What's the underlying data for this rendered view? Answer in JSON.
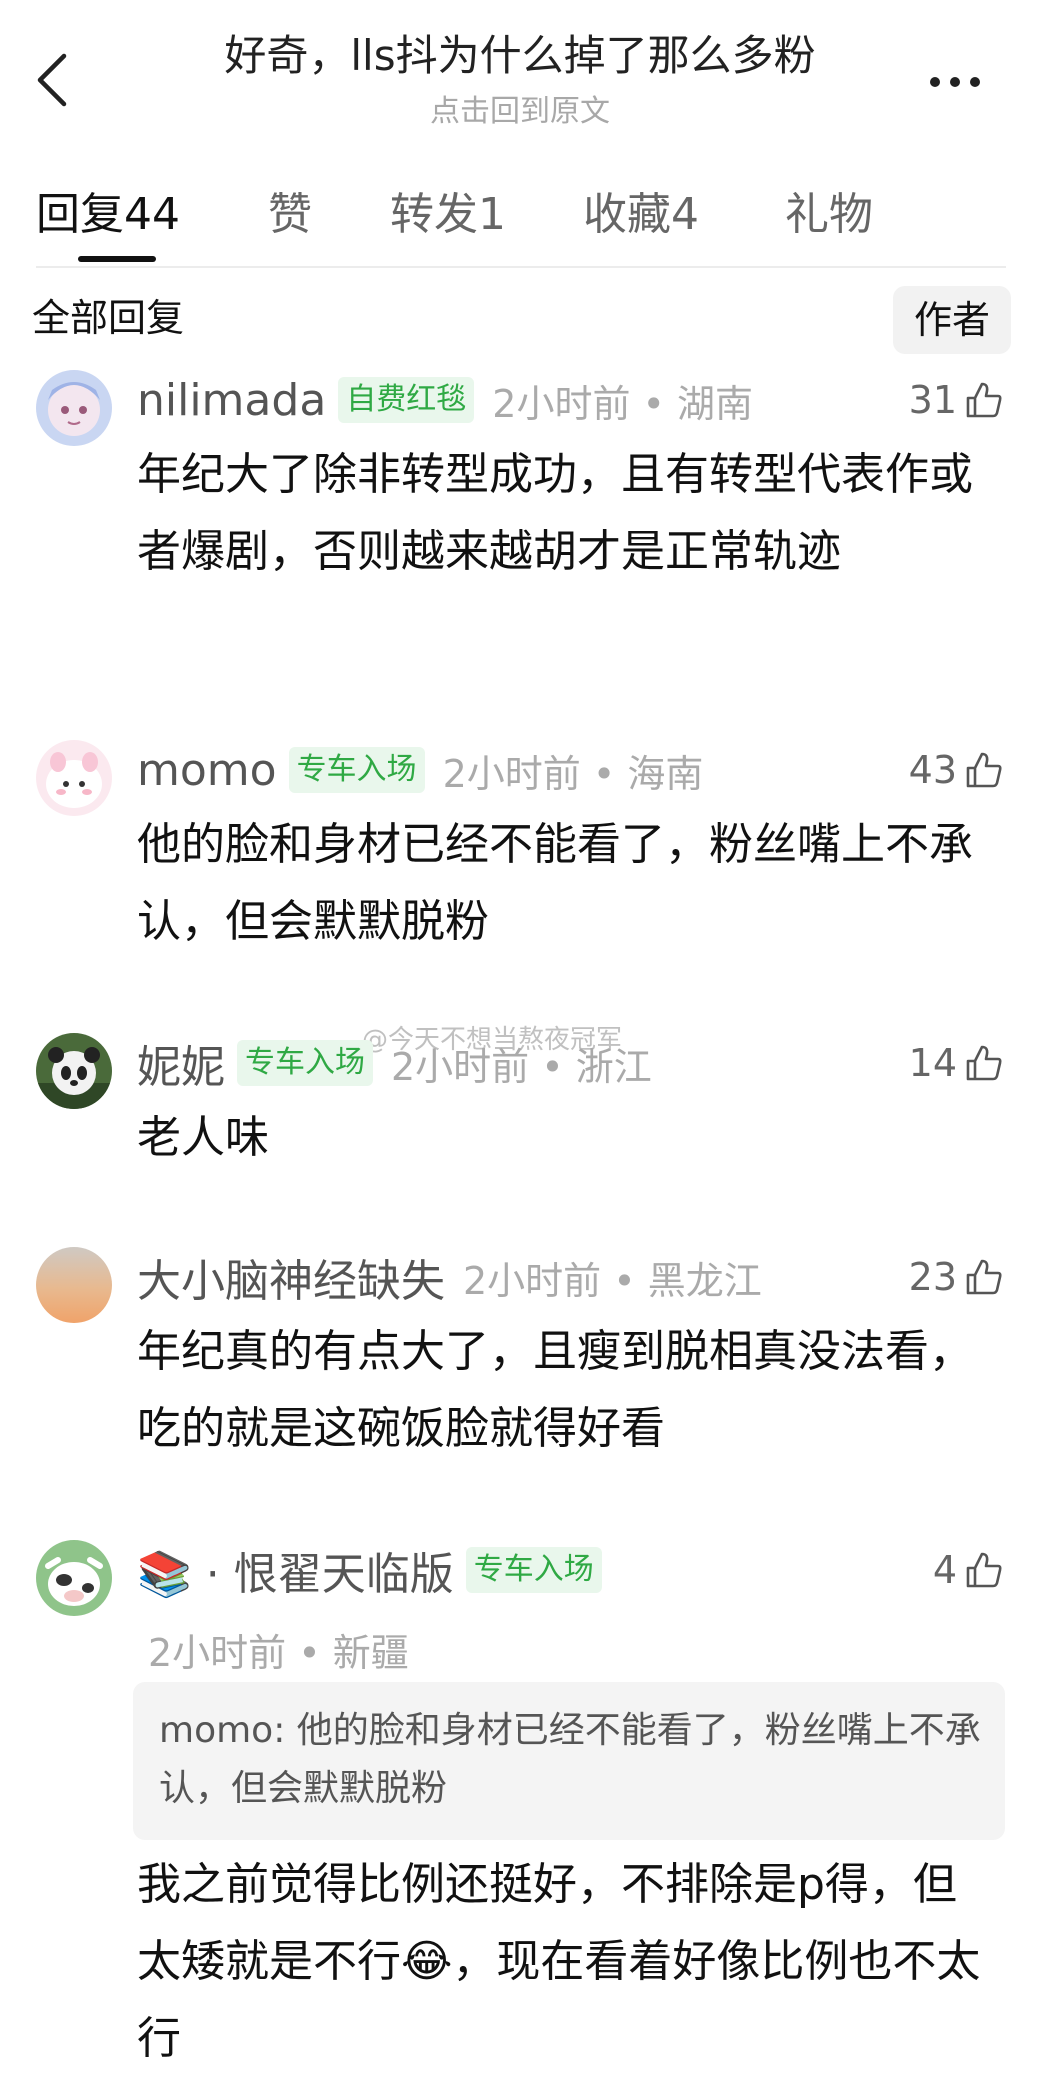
{
  "header": {
    "title": "好奇，lls抖为什么掉了那么多粉",
    "subtitle": "点击回到原文"
  },
  "tabs": [
    {
      "label": "回复",
      "count": "44"
    },
    {
      "label": "赞",
      "count": ""
    },
    {
      "label": "转发",
      "count": "1"
    },
    {
      "label": "收藏",
      "count": "4"
    },
    {
      "label": "礼物",
      "count": ""
    }
  ],
  "filter": {
    "label": "全部回复",
    "author_button": "作者"
  },
  "watermark": "@今天不想当熬夜冠军",
  "colors": {
    "badge_bg": "#e9f7ec",
    "badge_text": "#2fa944",
    "meta_text": "#aaaaaa"
  },
  "comments": [
    {
      "username": "nilimada",
      "badge": "自费红毯",
      "time": "2小时前",
      "location": "湖南",
      "likes": "31",
      "text": "年纪大了除非转型成功，且有转型代表作或者爆剧，否则越来越胡才是正常轨迹"
    },
    {
      "username": "momo",
      "badge": "专车入场",
      "time": "2小时前",
      "location": "海南",
      "likes": "43",
      "text": "他的脸和身材已经不能看了，粉丝嘴上不承认，但会默默脱粉"
    },
    {
      "username": "妮妮",
      "badge": "专车入场",
      "time": "2小时前",
      "location": "浙江",
      "likes": "14",
      "text": "老人味"
    },
    {
      "username": "大小脑神经缺失",
      "badge": "",
      "time": "2小时前",
      "location": "黑龙江",
      "likes": "23",
      "text": "年纪真的有点大了，且瘦到脱相真没法看，吃的就是这碗饭脸就得好看"
    },
    {
      "username": "📚 · 恨翟天临版",
      "badge": "专车入场",
      "time": "2小时前",
      "location": "新疆",
      "likes": "4",
      "quote_user": "momo",
      "quote_text": "他的脸和身材已经不能看了，粉丝嘴上不承认，但会默默脱粉",
      "text": "我之前觉得比例还挺好，不排除是p得，但太矮就是不行😂，现在看着好像比例也不太行"
    }
  ]
}
